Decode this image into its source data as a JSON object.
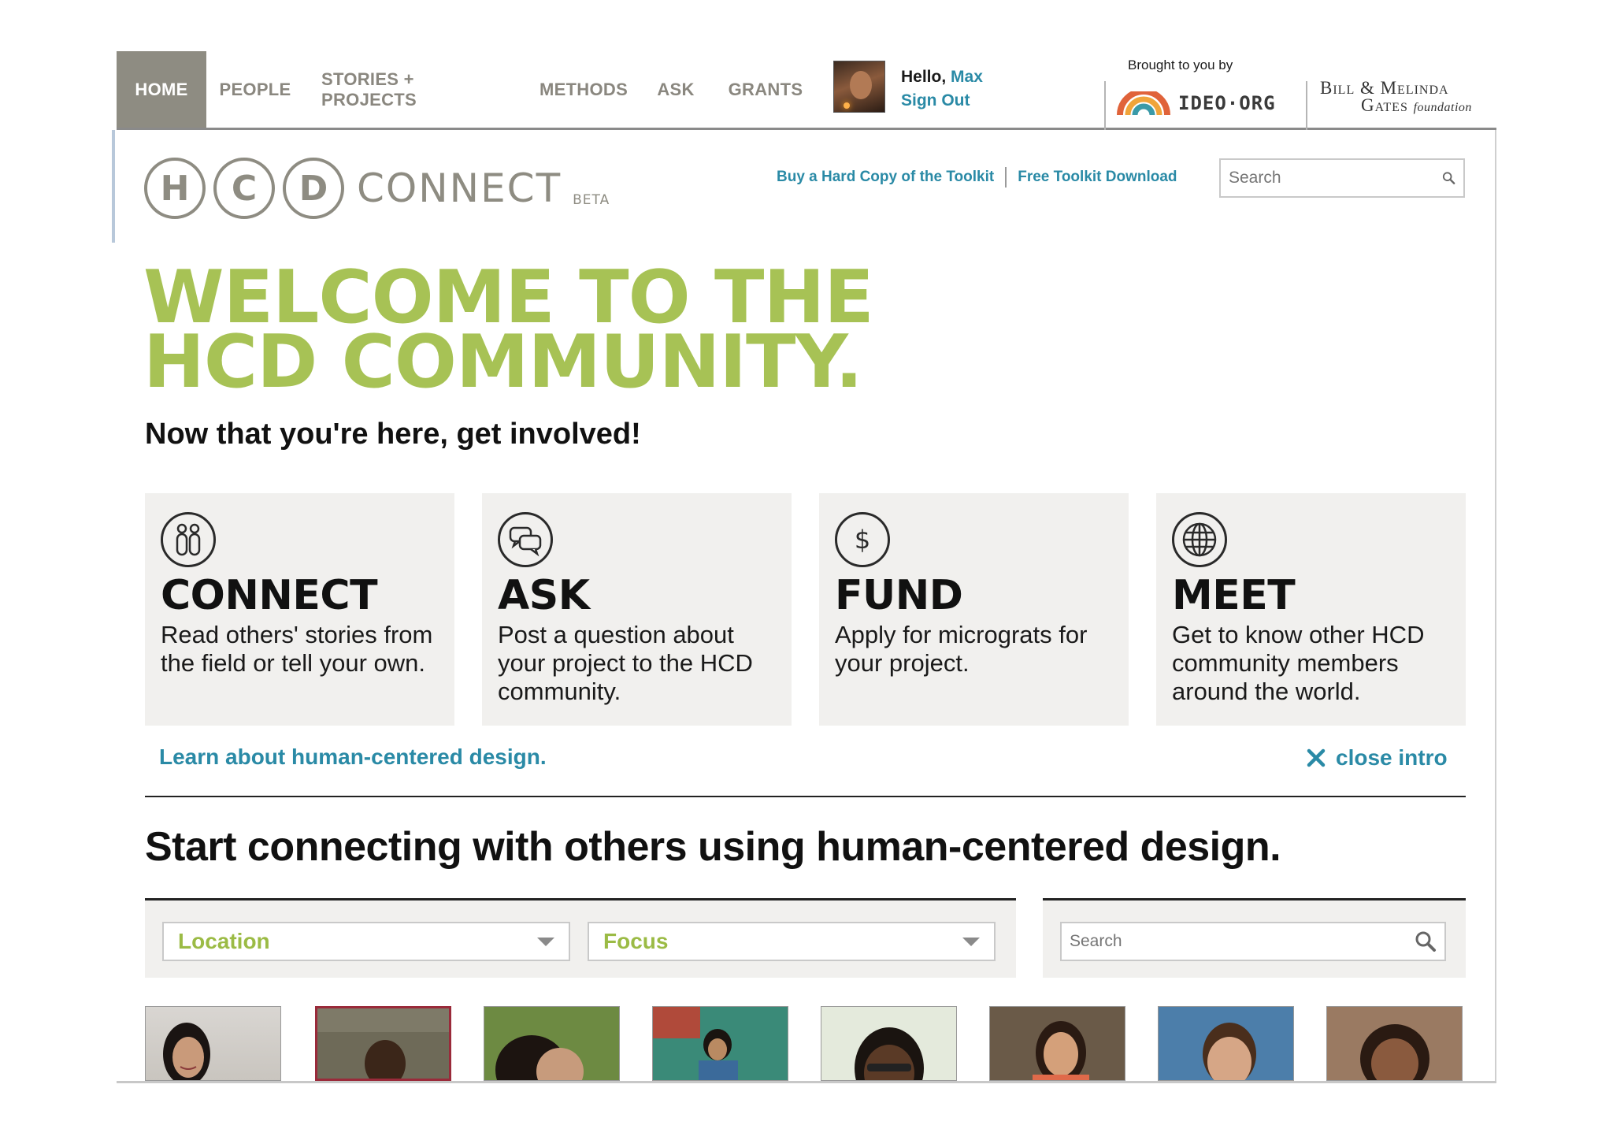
{
  "nav": {
    "items": [
      {
        "label": "HOME",
        "active": true
      },
      {
        "label": "PEOPLE",
        "active": false
      },
      {
        "label": "STORIES + PROJECTS",
        "active": false
      },
      {
        "label": "METHODS",
        "active": false
      },
      {
        "label": "ASK",
        "active": false
      },
      {
        "label": "GRANTS",
        "active": false
      }
    ]
  },
  "user": {
    "hello": "Hello, ",
    "name": "Max",
    "sign_out": "Sign Out"
  },
  "sponsors": {
    "brought_by": "Brought to you by",
    "ideo": "IDEO·ORG",
    "gates_line1": "Bill & Melinda",
    "gates_line2": "Gates",
    "gates_foundation": "foundation"
  },
  "logo": {
    "letters": [
      "H",
      "C",
      "D"
    ],
    "connect": "CONNECT",
    "beta": "BETA"
  },
  "toolkit": {
    "buy_label": "Buy a Hard Copy of the Toolkit",
    "download_label": "Free Toolkit Download"
  },
  "top_search": {
    "placeholder": "Search"
  },
  "welcome": {
    "line1": "WELCOME TO THE",
    "line2": "HCD COMMUNITY.",
    "subhead": "Now that you're here, get involved!"
  },
  "cards": [
    {
      "icon": "people-icon",
      "title": "CONNECT",
      "text": "Read others' stories from the field or tell your own."
    },
    {
      "icon": "speech-bubbles-icon",
      "title": "ASK",
      "text": "Post a question about your project to the HCD community."
    },
    {
      "icon": "dollar-icon",
      "title": "FUND",
      "text": "Apply for micrograts for your project."
    },
    {
      "icon": "globe-icon",
      "title": "MEET",
      "text": "Get to know other HCD community members around the world."
    }
  ],
  "intro_links": {
    "learn": "Learn about human-centered design.",
    "close": "close intro"
  },
  "start_heading": "Start connecting with others using human-centered design.",
  "filters": {
    "location": "Location",
    "focus": "Focus",
    "search_placeholder": "Search"
  },
  "colors": {
    "accent_green": "#a7c255",
    "link_blue": "#2a8aa6",
    "nav_gray": "#8e8c82",
    "card_bg": "#f1f0ee"
  },
  "people": [
    {
      "name": "person-1"
    },
    {
      "name": "person-2"
    },
    {
      "name": "person-3"
    },
    {
      "name": "person-4"
    },
    {
      "name": "person-5"
    },
    {
      "name": "person-6"
    },
    {
      "name": "person-7"
    },
    {
      "name": "person-8"
    }
  ]
}
